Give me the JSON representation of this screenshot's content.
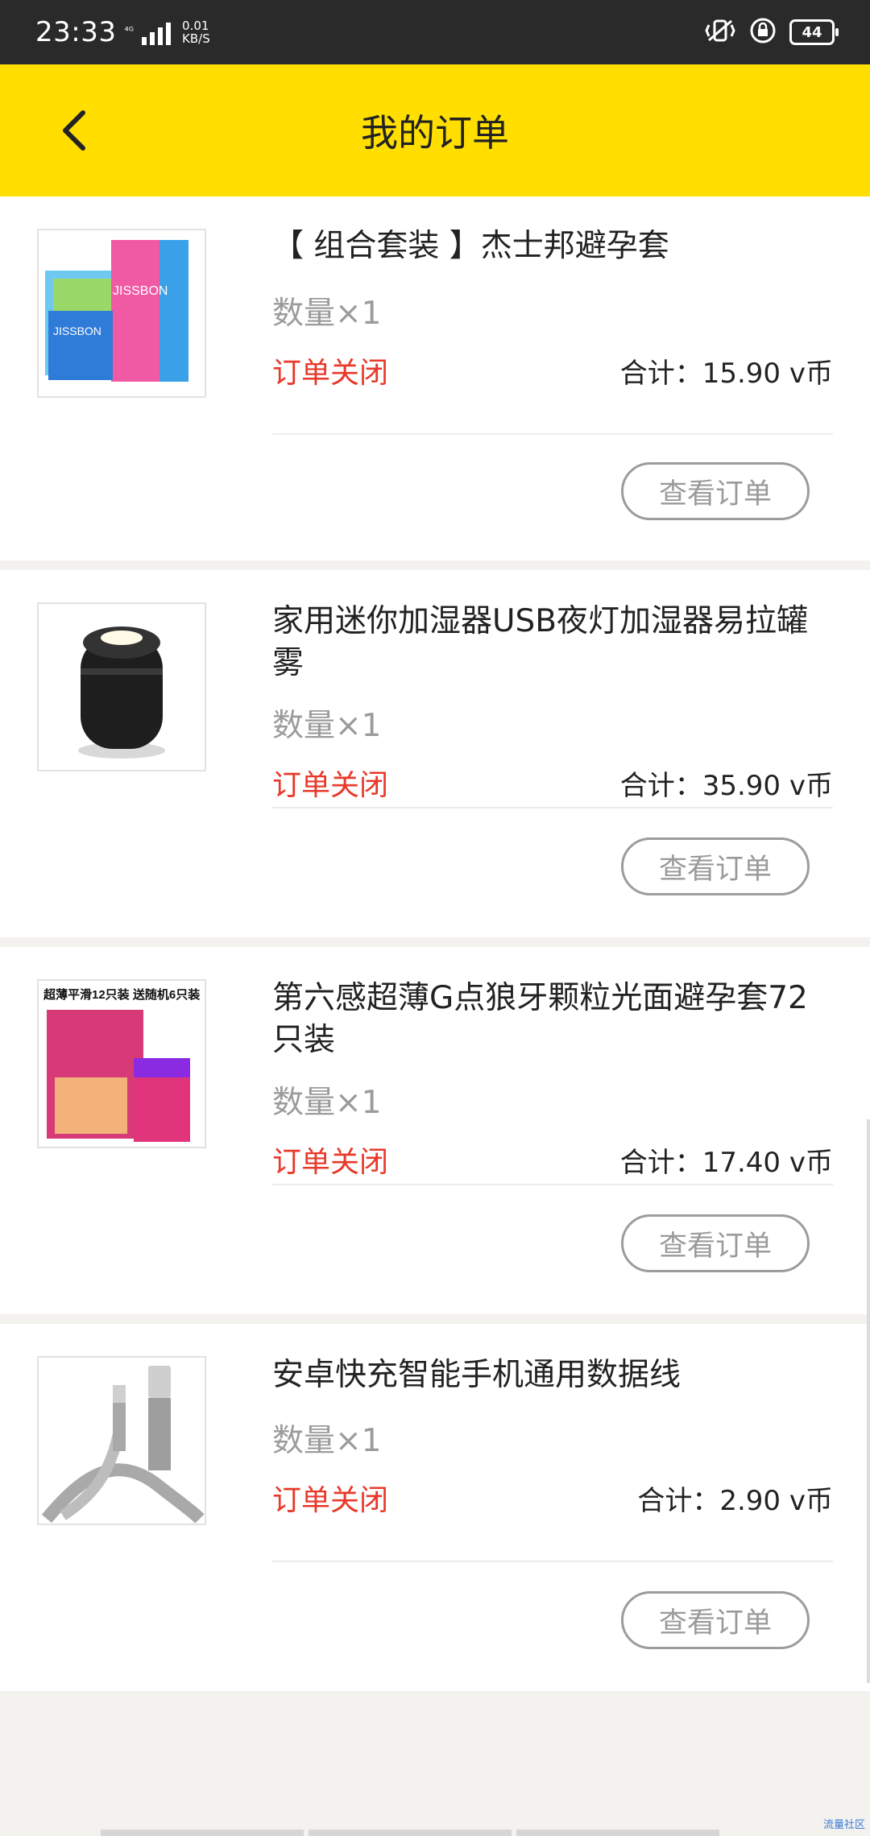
{
  "status_bar": {
    "time": "23:33",
    "net_line1": "⁴ᴳ",
    "net_rate_top": "0.01",
    "net_rate_bottom": "KB/S",
    "battery": "44"
  },
  "header": {
    "title": "我的订单"
  },
  "orders": [
    {
      "name": "【 组合套装 】杰士邦避孕套",
      "qty": "数量×1",
      "status": "订单关闭",
      "total": "合计：15.90 v币",
      "button": "查看订单",
      "thumb_label": "JISSBON"
    },
    {
      "name": "家用迷你加湿器USB夜灯加湿器易拉罐雾",
      "qty": "数量×1",
      "status": "订单关闭",
      "total": "合计：35.90 v币",
      "button": "查看订单",
      "thumb_label": ""
    },
    {
      "name": "第六感超薄G点狼牙颗粒光面避孕套72只装",
      "qty": "数量×1",
      "status": "订单关闭",
      "total": "合计：17.40 v币",
      "button": "查看订单",
      "thumb_label": "超薄平滑12只装 送随机6只装"
    },
    {
      "name": "安卓快充智能手机通用数据线",
      "qty": "数量×1",
      "status": "订单关闭",
      "total": "合计：2.90 v币",
      "button": "查看订单",
      "thumb_label": ""
    }
  ],
  "colors": {
    "header": "#ffde00",
    "status_text": "#e8392b",
    "status_bar": "#2a2a2a"
  },
  "watermark": "流量社区"
}
